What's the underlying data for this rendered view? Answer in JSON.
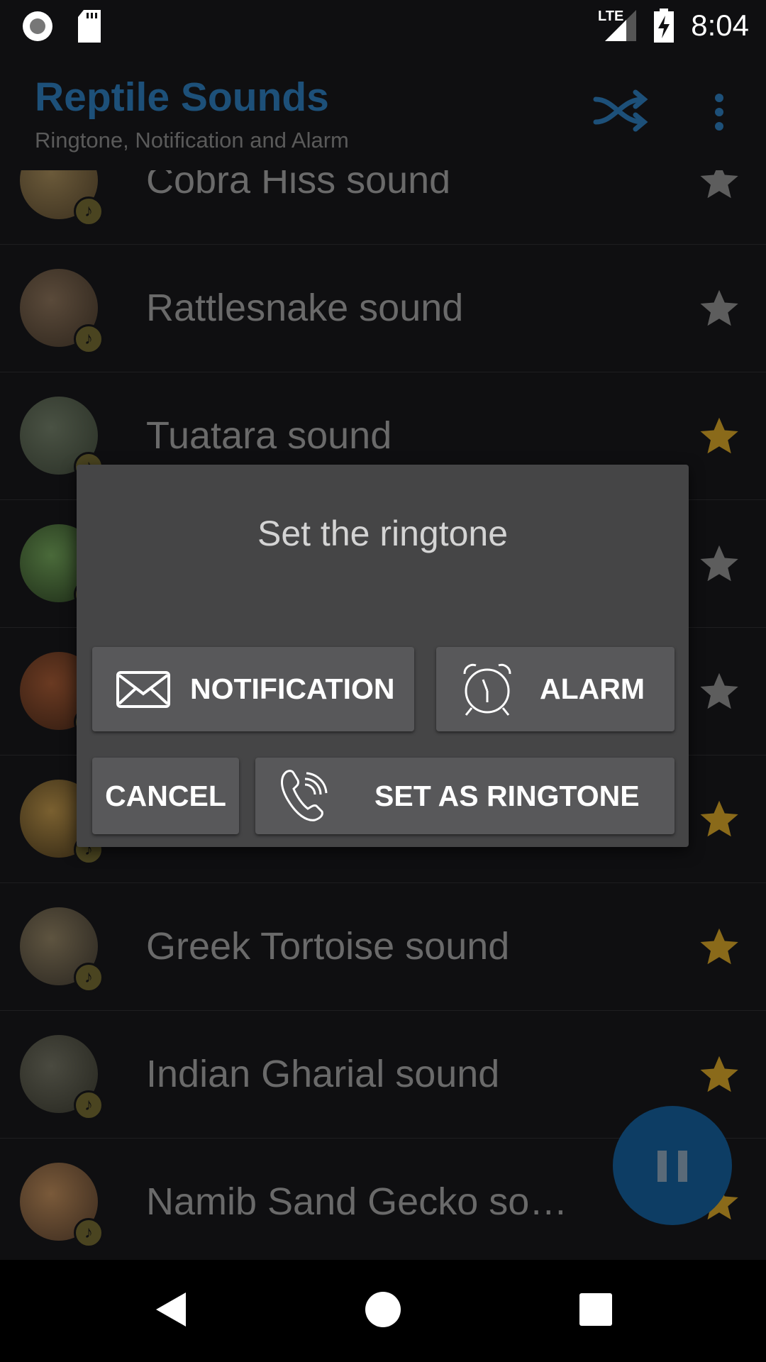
{
  "status_bar": {
    "time": "8:04",
    "network": "LTE",
    "icons": [
      "record-icon",
      "sd-card-icon",
      "signal-icon",
      "battery-charging-icon"
    ]
  },
  "app_bar": {
    "title": "Reptile Sounds",
    "subtitle": "Ringtone, Notification and Alarm",
    "actions": [
      "shuffle-icon",
      "more-vert-icon"
    ]
  },
  "colors": {
    "accent": "#1d5079",
    "star_active": "#8a6a1a",
    "star_inactive": "#5d5d5d",
    "dialog_bg": "#454546",
    "button_bg": "#58585a"
  },
  "list": {
    "items": [
      {
        "title": "Cobra Hiss sound",
        "favorite": false
      },
      {
        "title": "Rattlesnake sound",
        "favorite": false
      },
      {
        "title": "Tuatara sound",
        "favorite": true
      },
      {
        "title": "",
        "favorite": false
      },
      {
        "title": "",
        "favorite": false
      },
      {
        "title": "",
        "favorite": true
      },
      {
        "title": "Greek Tortoise sound",
        "favorite": true
      },
      {
        "title": "Indian Gharial sound",
        "favorite": true
      },
      {
        "title": "Namib Sand Gecko so…",
        "favorite": true
      }
    ]
  },
  "dialog": {
    "title": "Set the ringtone",
    "notification_label": "NOTIFICATION",
    "alarm_label": "ALARM",
    "cancel_label": "CANCEL",
    "ringtone_label": "SET AS RINGTONE"
  },
  "fab": {
    "icon": "pause-icon"
  },
  "nav_bar": {
    "icons": [
      "back-icon",
      "home-icon",
      "recents-icon"
    ]
  }
}
